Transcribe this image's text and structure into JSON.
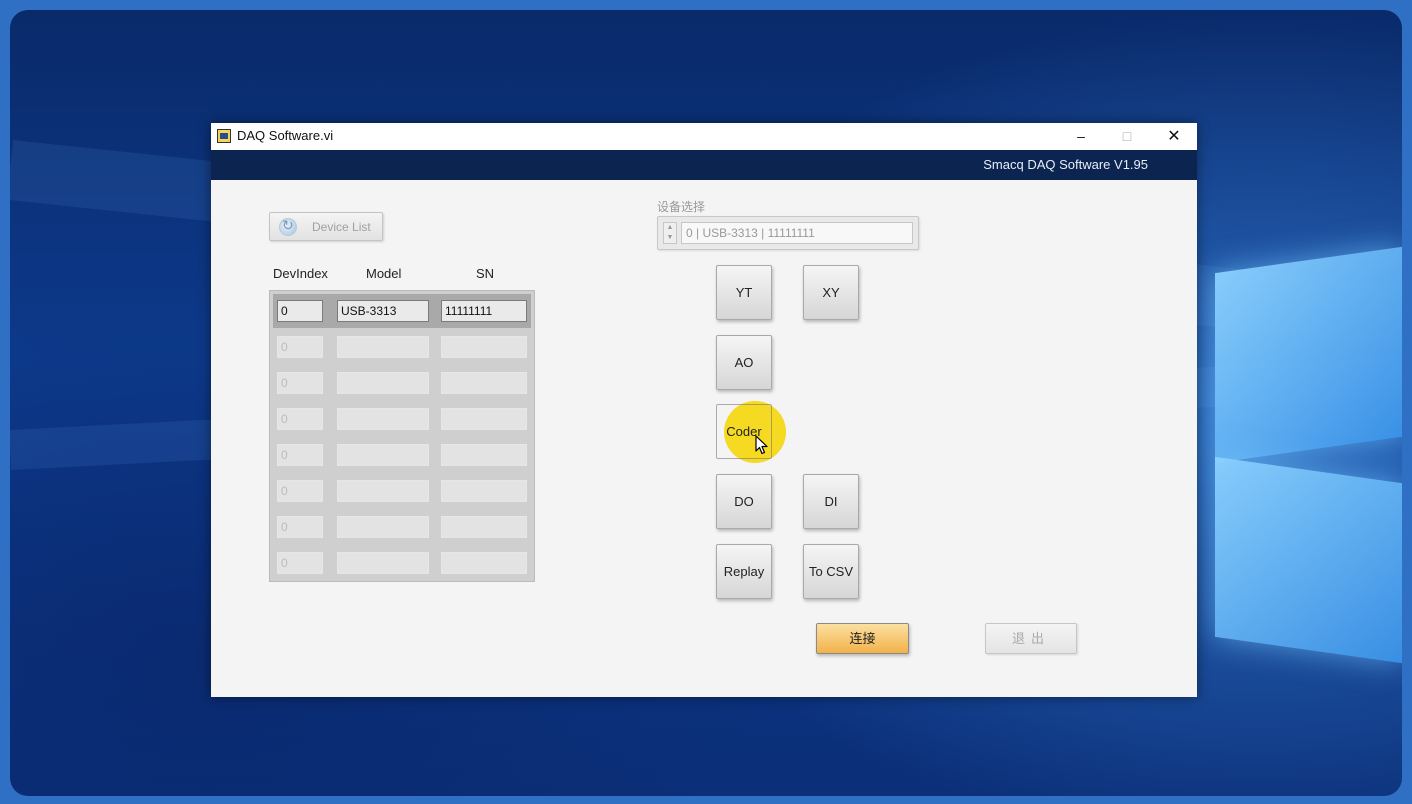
{
  "window": {
    "title": "DAQ Software.vi",
    "controls": {
      "minimize": "–",
      "maximize": "□",
      "close": "✕"
    }
  },
  "banner": {
    "text": "Smacq DAQ Software V1.95"
  },
  "device_list_button": {
    "label": "Device List",
    "icon": "refresh-icon"
  },
  "table": {
    "headers": [
      "DevIndex",
      "Model",
      "SN"
    ],
    "rows": [
      {
        "index": "0",
        "model": "USB-3313",
        "sn": "11111111"
      },
      {
        "index": "0",
        "model": "",
        "sn": ""
      },
      {
        "index": "0",
        "model": "",
        "sn": ""
      },
      {
        "index": "0",
        "model": "",
        "sn": ""
      },
      {
        "index": "0",
        "model": "",
        "sn": ""
      },
      {
        "index": "0",
        "model": "",
        "sn": ""
      },
      {
        "index": "0",
        "model": "",
        "sn": ""
      },
      {
        "index": "0",
        "model": "",
        "sn": ""
      }
    ]
  },
  "device_select": {
    "label": "设备选择",
    "value": "0 | USB-3313 | 11111111"
  },
  "mode_buttons": {
    "yt": "YT",
    "xy": "XY",
    "ao": "AO",
    "coder": "Coder",
    "do": "DO",
    "di": "DI",
    "replay": "Replay",
    "to_csv": "To CSV"
  },
  "connect_button": "连接",
  "exit_button": "退出",
  "colors": {
    "banner": "#0b2450",
    "connect_accent": "#f3b24a",
    "cursor_highlight": "#f5d70a"
  }
}
